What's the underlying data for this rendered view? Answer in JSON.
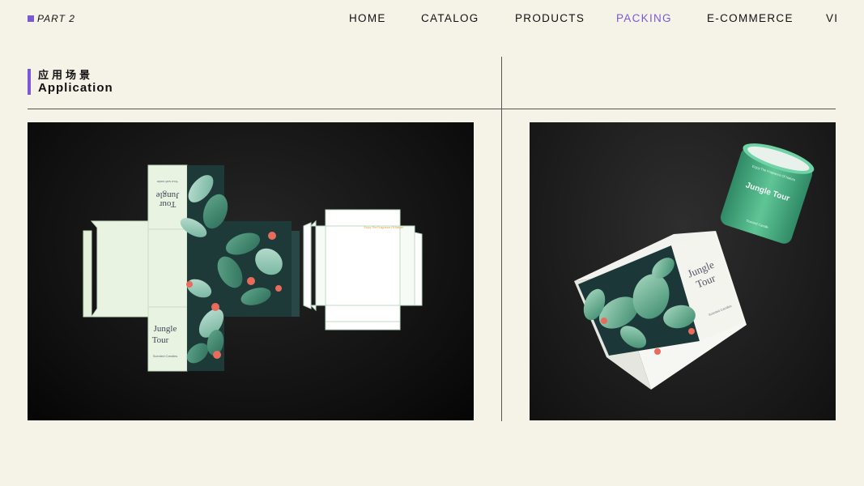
{
  "header": {
    "part_label": "PART 2",
    "nav": [
      {
        "label": "HOME",
        "active": false
      },
      {
        "label": "CATALOG",
        "active": false
      },
      {
        "label": "PRODUCTS",
        "active": false
      },
      {
        "label": "PACKING",
        "active": true
      },
      {
        "label": "E-COMMERCE",
        "active": false
      },
      {
        "label": "VI",
        "active": false
      }
    ]
  },
  "section": {
    "title_zh": "应用场景",
    "title_en": "Application"
  },
  "dieline": {
    "brand": "Jungle",
    "brand2": "Tour",
    "subtitle": "Scented Candles",
    "tagline": "Your soft smile"
  },
  "mockup": {
    "box_brand": "Jungle",
    "box_brand2": "Tour",
    "box_subtitle": "Scented Candles",
    "jar_label": "Jungle Tour",
    "jar_tag": "Enjoy The Fragrance Of Nature",
    "jar_sub": "Scented Candle"
  },
  "colors": {
    "accent": "#7b57d9",
    "background": "#f5f3e8",
    "mint": "#e8f3e2",
    "jar_green": "#4fb38a"
  }
}
